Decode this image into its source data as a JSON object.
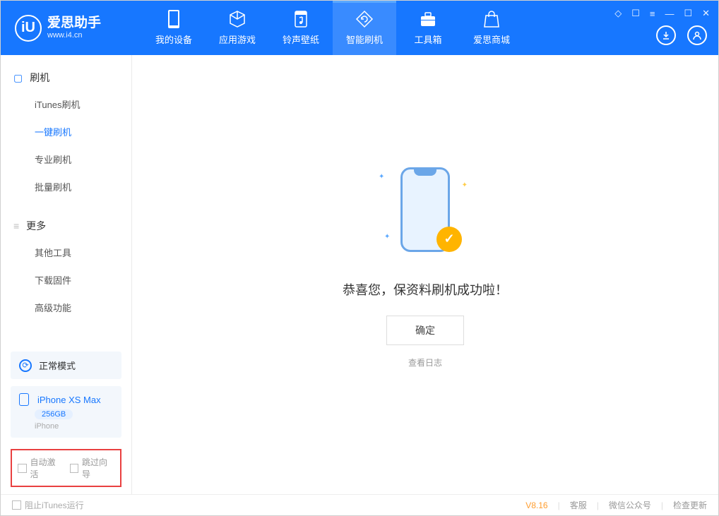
{
  "app": {
    "title": "爱思助手",
    "url": "www.i4.cn"
  },
  "nav": {
    "items": [
      {
        "label": "我的设备",
        "icon": "device-icon"
      },
      {
        "label": "应用游戏",
        "icon": "cube-icon"
      },
      {
        "label": "铃声壁纸",
        "icon": "music-icon"
      },
      {
        "label": "智能刷机",
        "icon": "refresh-icon"
      },
      {
        "label": "工具箱",
        "icon": "toolbox-icon"
      },
      {
        "label": "爱思商城",
        "icon": "store-icon"
      }
    ],
    "activeIndex": 3
  },
  "sidebar": {
    "section1": {
      "title": "刷机",
      "items": [
        {
          "label": "iTunes刷机"
        },
        {
          "label": "一键刷机"
        },
        {
          "label": "专业刷机"
        },
        {
          "label": "批量刷机"
        }
      ],
      "activeIndex": 1
    },
    "section2": {
      "title": "更多",
      "items": [
        {
          "label": "其他工具"
        },
        {
          "label": "下载固件"
        },
        {
          "label": "高级功能"
        }
      ]
    },
    "mode": {
      "label": "正常模式"
    },
    "device": {
      "name": "iPhone XS Max",
      "storage": "256GB",
      "type": "iPhone"
    },
    "checks": {
      "autoActivate": "自动激活",
      "skipGuide": "跳过向导"
    }
  },
  "main": {
    "message": "恭喜您，保资料刷机成功啦！",
    "okButton": "确定",
    "logLink": "查看日志"
  },
  "footer": {
    "blockItunes": "阻止iTunes运行",
    "version": "V8.16",
    "links": {
      "support": "客服",
      "wechat": "微信公众号",
      "update": "检查更新"
    }
  }
}
